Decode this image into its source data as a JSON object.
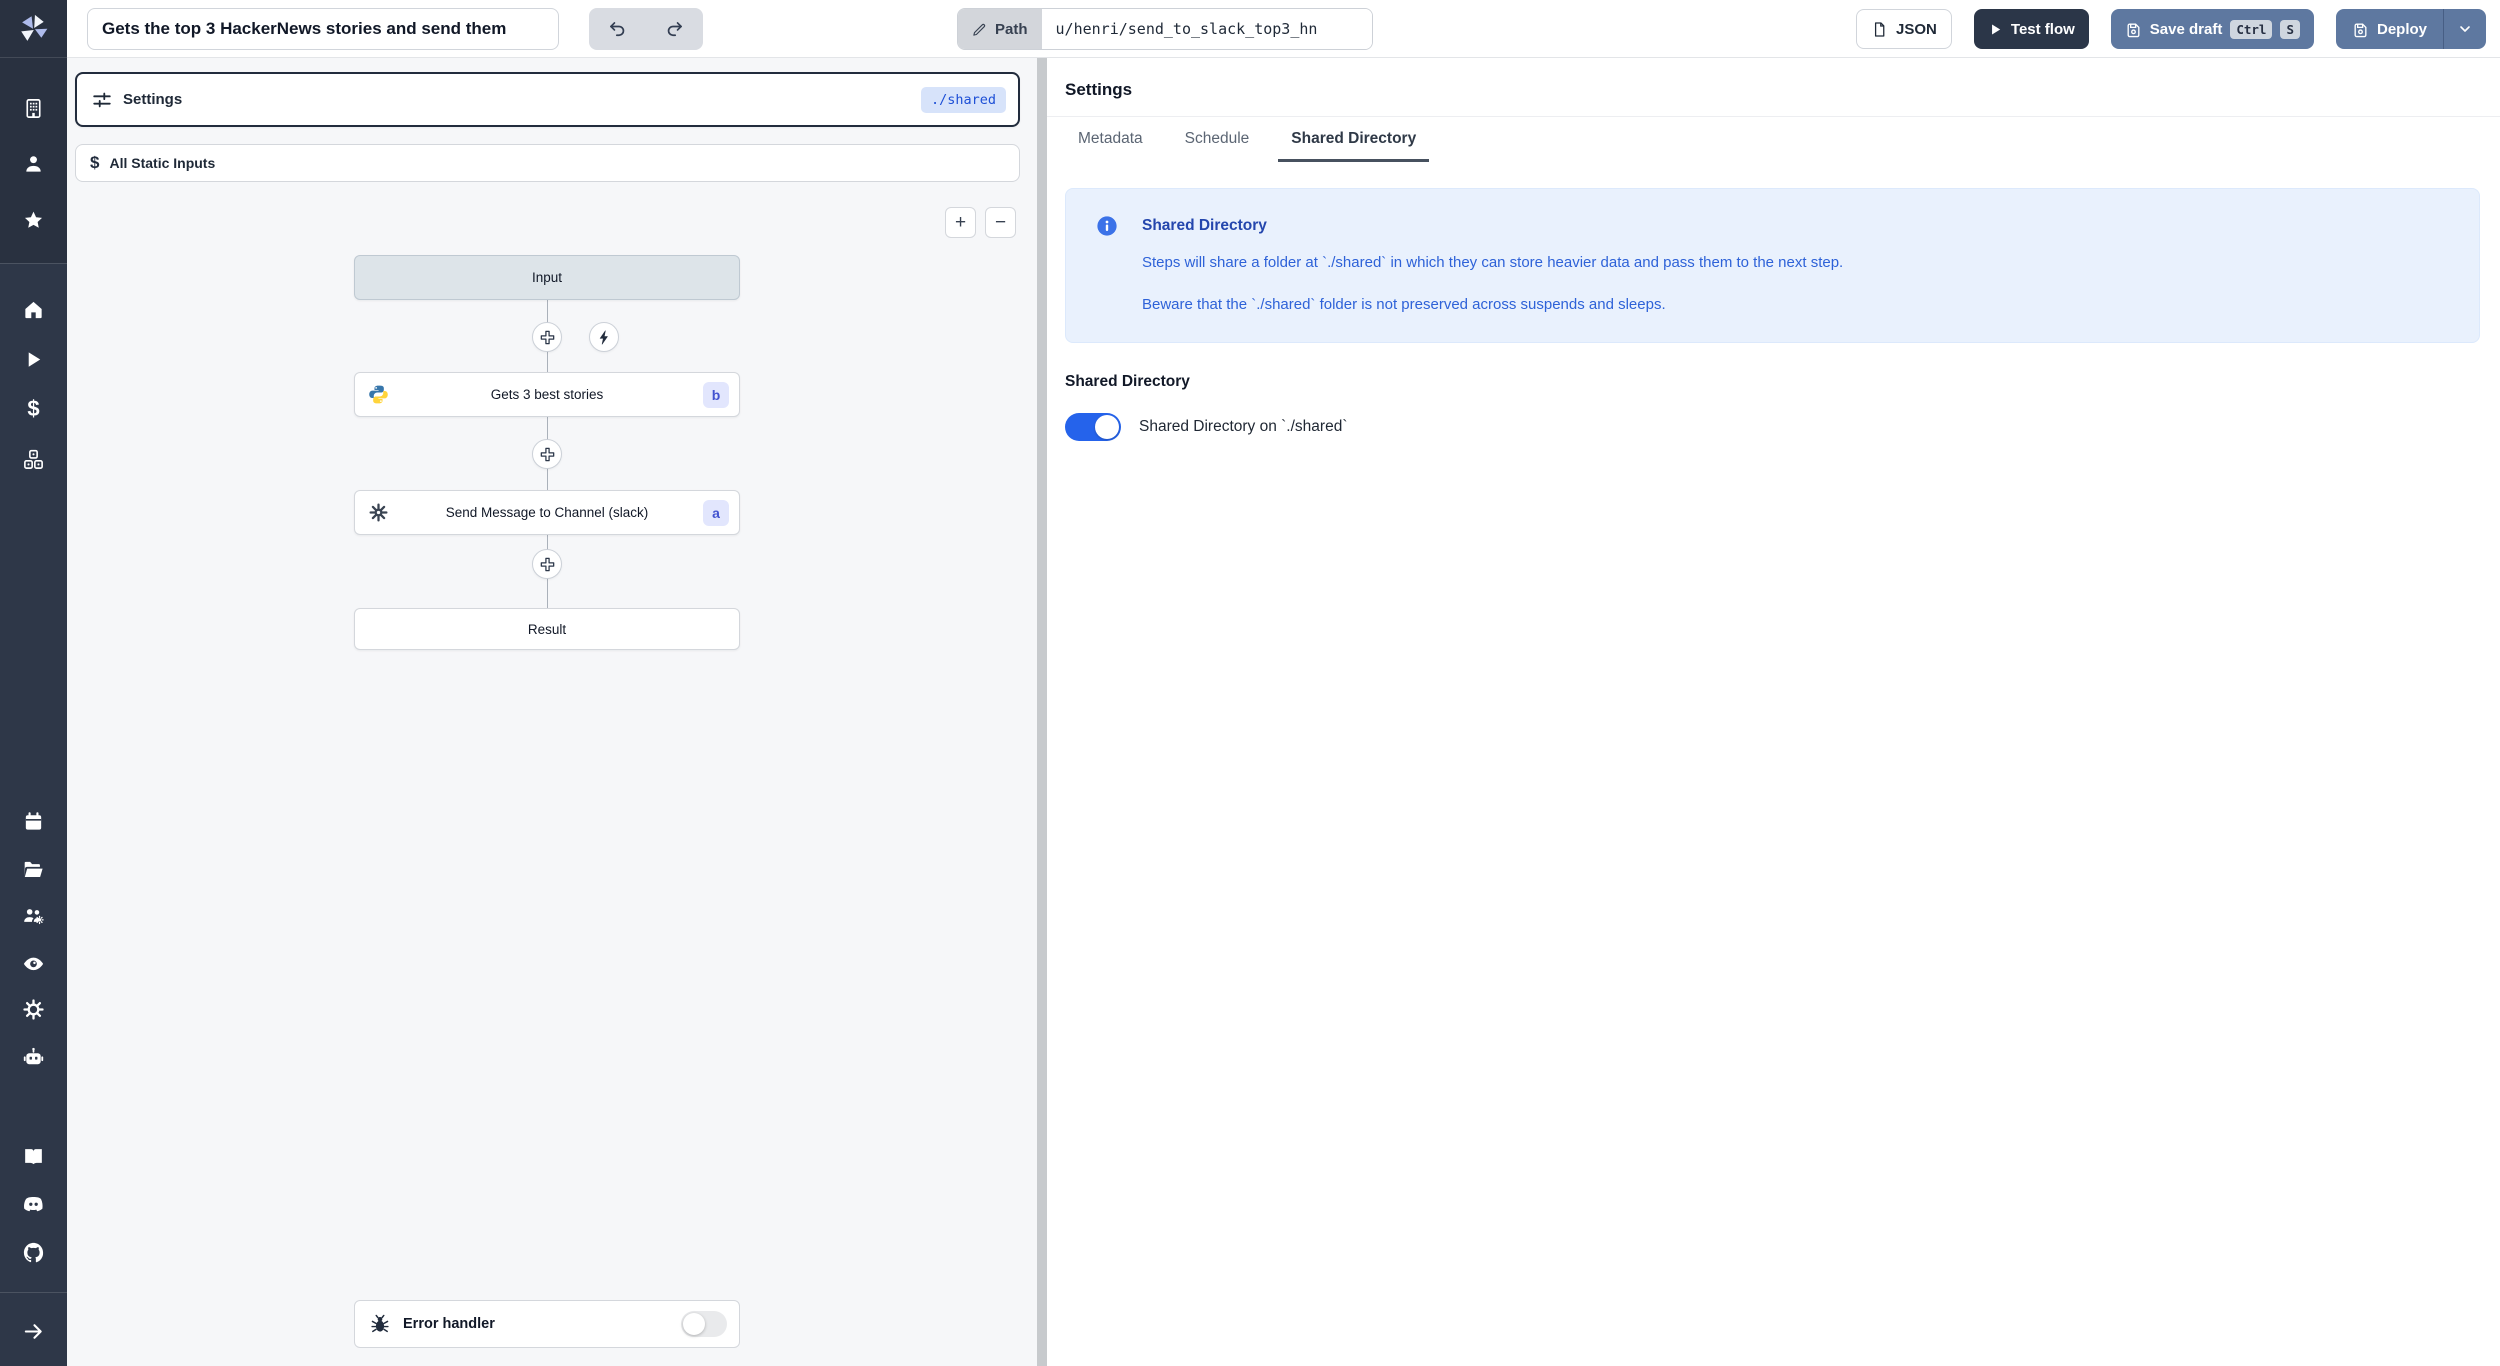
{
  "topbar": {
    "title_value": "Gets the top 3 HackerNews stories and send them",
    "path_label": "Path",
    "path_value": "u/henri/send_to_slack_top3_hn",
    "json_label": "JSON",
    "test_flow_label": "Test flow",
    "save_draft_label": "Save draft",
    "kbd": [
      "Ctrl",
      "S"
    ],
    "deploy_label": "Deploy"
  },
  "sidebar": {
    "icons": [
      "workspace",
      "user",
      "favorites",
      "home",
      "runs",
      "variables",
      "resources",
      "schedules",
      "folders",
      "groups",
      "audit-logs",
      "settings",
      "ai",
      "docs",
      "discord",
      "github",
      "expand"
    ]
  },
  "flow_panel": {
    "settings_card": {
      "label": "Settings",
      "badge": "./shared"
    },
    "static_inputs_label": "All Static Inputs",
    "zoom_in": "+",
    "zoom_out": "−",
    "nodes": {
      "input": {
        "label": "Input"
      },
      "step_b": {
        "label": "Gets 3 best stories",
        "badge": "b",
        "language": "python"
      },
      "step_a": {
        "label": "Send Message to Channel (slack)",
        "badge": "a"
      },
      "result": {
        "label": "Result"
      },
      "error_handler": {
        "label": "Error handler",
        "toggle_state": "off"
      }
    }
  },
  "right_panel": {
    "heading": "Settings",
    "tabs": [
      {
        "label": "Metadata",
        "active": false
      },
      {
        "label": "Schedule",
        "active": false
      },
      {
        "label": "Shared Directory",
        "active": true
      }
    ],
    "info_box": {
      "title": "Shared Directory",
      "line1": "Steps will share a folder at `./shared` in which they can store heavier data and pass them to the next step.",
      "line2": "Beware that the `./shared` folder is not preserved across suspends and sleeps."
    },
    "section_heading": "Shared Directory",
    "toggle_label": "Shared Directory on `./shared`",
    "toggle_state": "on"
  },
  "colors": {
    "sidebar_bg": "#2e3748",
    "primary_button": "#5e78a0",
    "dark_button": "#2b3648",
    "accent_blue": "#2563eb",
    "info_bg": "#e9f1fd",
    "info_text": "#2e62d8",
    "badge_bg": "#e2e6fd",
    "badge_text": "#4353d0",
    "shared_badge_bg": "#d7e3fa",
    "shared_badge_text": "#1d4fd6",
    "canvas_bg": "#f6f7f9"
  }
}
